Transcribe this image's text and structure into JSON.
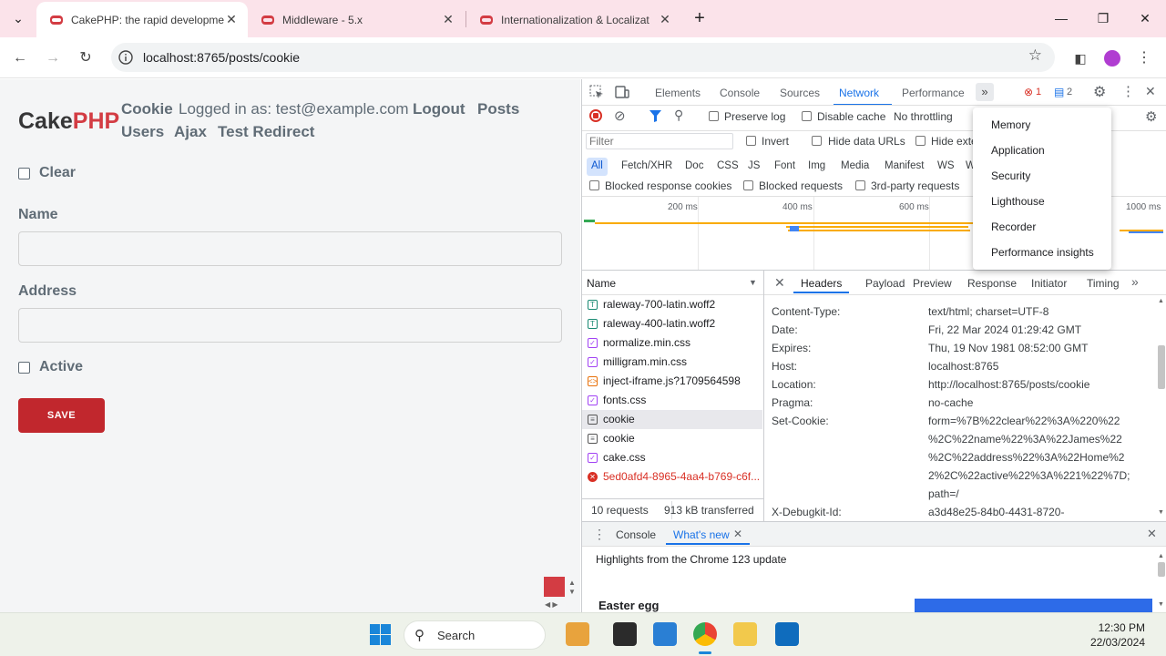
{
  "tabs": [
    {
      "title": "CakePHP: the rapid developme",
      "active": true
    },
    {
      "title": "Middleware - 5.x",
      "active": false
    },
    {
      "title": "Internationalization & Localizat",
      "active": false
    }
  ],
  "address": {
    "url": "localhost:8765/posts/cookie"
  },
  "page": {
    "brand_cake": "Cake",
    "brand_php": "PHP",
    "nav": {
      "cookie": "Cookie",
      "logged_in": "Logged in as: test@example.com",
      "logout": "Logout",
      "posts": "Posts",
      "users": "Users",
      "ajax": "Ajax",
      "test_redirect": "Test Redirect"
    },
    "clear_label": "Clear",
    "name_label": "Name",
    "address_label": "Address",
    "active_label": "Active",
    "save_button": "SAVE"
  },
  "devtools": {
    "tabs": [
      "Elements",
      "Console",
      "Sources",
      "Network",
      "Performance"
    ],
    "error_count": "1",
    "message_count": "2",
    "preserve_log": "Preserve log",
    "disable_cache": "Disable cache",
    "throttling": "No throttling",
    "filter_placeholder": "Filter",
    "invert": "Invert",
    "hide_data_urls": "Hide data URLs",
    "hide_ext": "Hide exte",
    "filter_types": [
      "All",
      "Fetch/XHR",
      "Doc",
      "CSS",
      "JS",
      "Font",
      "Img",
      "Media",
      "Manifest",
      "WS",
      "W"
    ],
    "blocked_cookies": "Blocked response cookies",
    "blocked_requests": "Blocked requests",
    "third_party": "3rd-party requests",
    "timeline_ticks": [
      "200 ms",
      "400 ms",
      "600 ms",
      "1000 ms"
    ],
    "name_col": "Name",
    "requests": [
      {
        "name": "raleway-700-latin.woff2",
        "type": "font"
      },
      {
        "name": "raleway-400-latin.woff2",
        "type": "font"
      },
      {
        "name": "normalize.min.css",
        "type": "css"
      },
      {
        "name": "milligram.min.css",
        "type": "css"
      },
      {
        "name": "inject-iframe.js?1709564598",
        "type": "js"
      },
      {
        "name": "fonts.css",
        "type": "css"
      },
      {
        "name": "cookie",
        "type": "doc"
      },
      {
        "name": "cookie",
        "type": "doc"
      },
      {
        "name": "cake.css",
        "type": "css"
      },
      {
        "name": "5ed0afd4-8965-4aa4-b769-c6f...",
        "type": "error"
      }
    ],
    "summary_requests": "10 requests",
    "summary_transferred": "913 kB transferred",
    "detail_tabs": [
      "Headers",
      "Payload",
      "Preview",
      "Response",
      "Initiator",
      "Timing"
    ],
    "headers": [
      {
        "key": "Content-Type:",
        "value": "text/html; charset=UTF-8"
      },
      {
        "key": "Date:",
        "value": "Fri, 22 Mar 2024 01:29:42 GMT"
      },
      {
        "key": "Expires:",
        "value": "Thu, 19 Nov 1981 08:52:00 GMT"
      },
      {
        "key": "Host:",
        "value": "localhost:8765"
      },
      {
        "key": "Location:",
        "value": "http://localhost:8765/posts/cookie"
      },
      {
        "key": "Pragma:",
        "value": "no-cache"
      },
      {
        "key": "Set-Cookie:",
        "value": "form=%7B%22clear%22%3A%220%22"
      }
    ],
    "set_cookie_cont": [
      "%2C%22name%22%3A%22James%22",
      "%2C%22address%22%3A%22Home%2",
      "2%2C%22active%22%3A%221%22%7D;",
      "path=/"
    ],
    "debugkit_key": "X-Debugkit-Id:",
    "debugkit_val": "a3d48e25-84b0-4431-8720-",
    "drawer_tabs": [
      "Console",
      "What's new"
    ],
    "drawer_highlight": "Highlights from the Chrome 123 update",
    "easter_egg": "Easter egg",
    "more_menu": [
      "Memory",
      "Application",
      "Security",
      "Lighthouse",
      "Recorder",
      "Performance insights"
    ]
  },
  "taskbar": {
    "search": "Search",
    "time": "12:30 PM",
    "date": "22/03/2024"
  },
  "colors": {
    "accent": "#d33c43",
    "brand": "#c1272d",
    "devtools_blue": "#1a73e8"
  }
}
